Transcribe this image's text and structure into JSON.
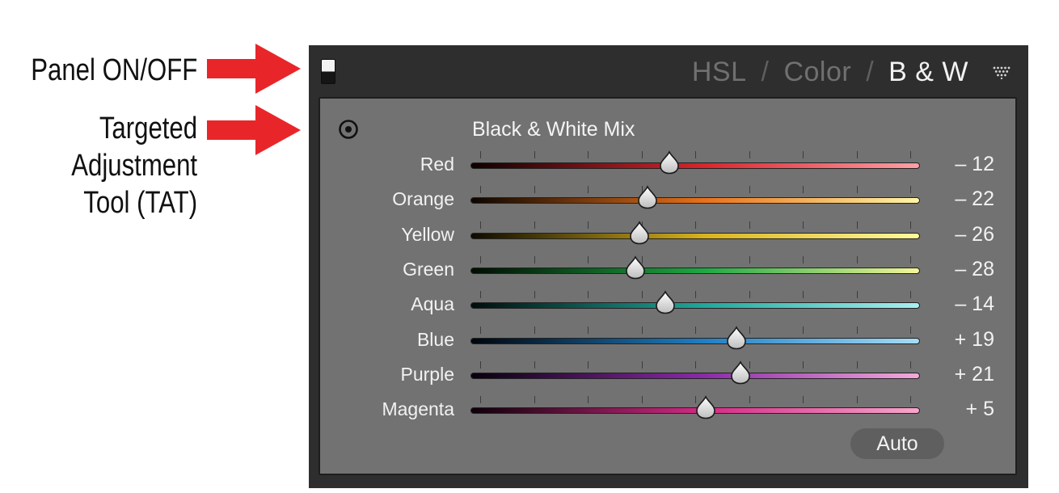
{
  "callouts": {
    "panel_toggle": "Panel ON/OFF",
    "tat_line1": "Targeted",
    "tat_line2": "Adjustment",
    "tat_line3": "Tool (TAT)",
    "arrow_color": "#e8262a"
  },
  "panel": {
    "tabs": [
      {
        "label": "HSL",
        "active": false
      },
      {
        "label": "Color",
        "active": false
      },
      {
        "label": "B & W",
        "active": true
      }
    ],
    "tab_separator": "/",
    "section_title": "Black & White Mix",
    "slider_range": [
      -100,
      100
    ],
    "sliders": [
      {
        "label": "Red",
        "value": -12,
        "display": "– 12",
        "from": "#0d0000",
        "to": "#ff9fa6",
        "mid": "#d9262d"
      },
      {
        "label": "Orange",
        "value": -22,
        "display": "– 22",
        "from": "#0d0500",
        "to": "#fff6a8",
        "mid": "#e8711a"
      },
      {
        "label": "Yellow",
        "value": -26,
        "display": "– 26",
        "from": "#0d0a00",
        "to": "#fffa9c",
        "mid": "#d9b21c"
      },
      {
        "label": "Green",
        "value": -28,
        "display": "– 28",
        "from": "#000d02",
        "to": "#f5f59a",
        "mid": "#1fa843"
      },
      {
        "label": "Aqua",
        "value": -14,
        "display": "– 14",
        "from": "#000d0c",
        "to": "#a9f0f2",
        "mid": "#20a89c"
      },
      {
        "label": "Blue",
        "value": 19,
        "display": "+ 19",
        "from": "#00050d",
        "to": "#a6dcf7",
        "mid": "#1f7fc4"
      },
      {
        "label": "Purple",
        "value": 21,
        "display": "+ 21",
        "from": "#08000d",
        "to": "#f2aad8",
        "mid": "#8b2aa8"
      },
      {
        "label": "Magenta",
        "value": 5,
        "display": "+ 5",
        "from": "#0d0008",
        "to": "#f7a6cc",
        "mid": "#d42a85"
      }
    ],
    "auto_label": "Auto"
  }
}
